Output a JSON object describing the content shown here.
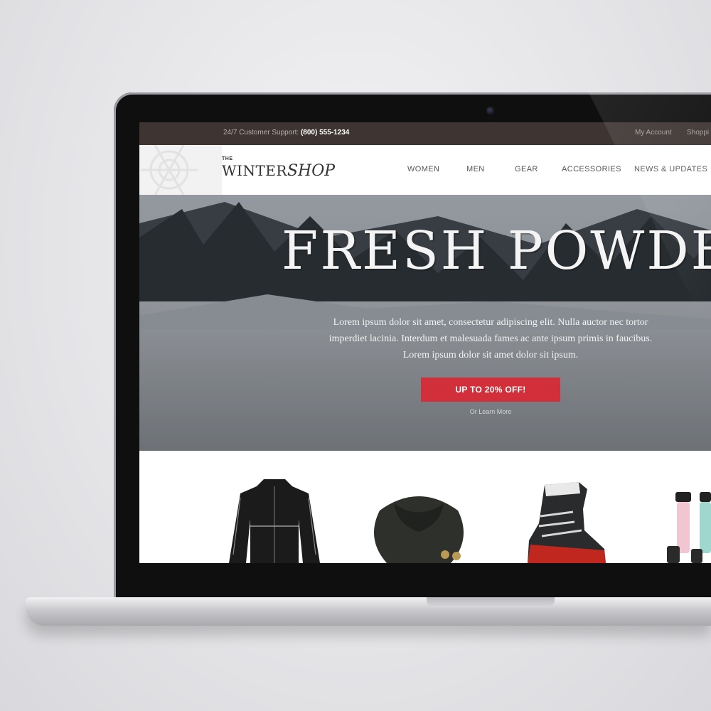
{
  "site": {
    "topbar": {
      "support_label": "24/7 Customer Support:",
      "support_phone": "(800) 555-1234",
      "links": [
        "My Account",
        "Shoppi"
      ]
    },
    "logo": {
      "prefix": "THE",
      "word1": "WINTER",
      "word2": "SHOP"
    },
    "nav": [
      "WOMEN",
      "MEN",
      "GEAR",
      "ACCESSORIES",
      "NEWS & UPDATES"
    ],
    "hero": {
      "title": "FRESH POWDER",
      "body": "Lorem ipsum dolor sit amet, consectetur adipiscing elit. Nulla auctor nec tortor imperdiet lacinia. Interdum et malesuada fames ac ante ipsum primis in faucibus. Lorem ipsum dolor sit amet dolor sit ipsum.",
      "cta_label": "UP TO 20% OFF!",
      "secondary_link": "Or Learn More"
    },
    "products": [
      {
        "icon": "jacket-icon"
      },
      {
        "icon": "scarf-icon"
      },
      {
        "icon": "ski-boot-icon"
      },
      {
        "icon": "thermos-icon"
      }
    ]
  },
  "colors": {
    "topbar_bg": "#3e3533",
    "cta": "#d1303a",
    "nav_text": "#555555"
  }
}
